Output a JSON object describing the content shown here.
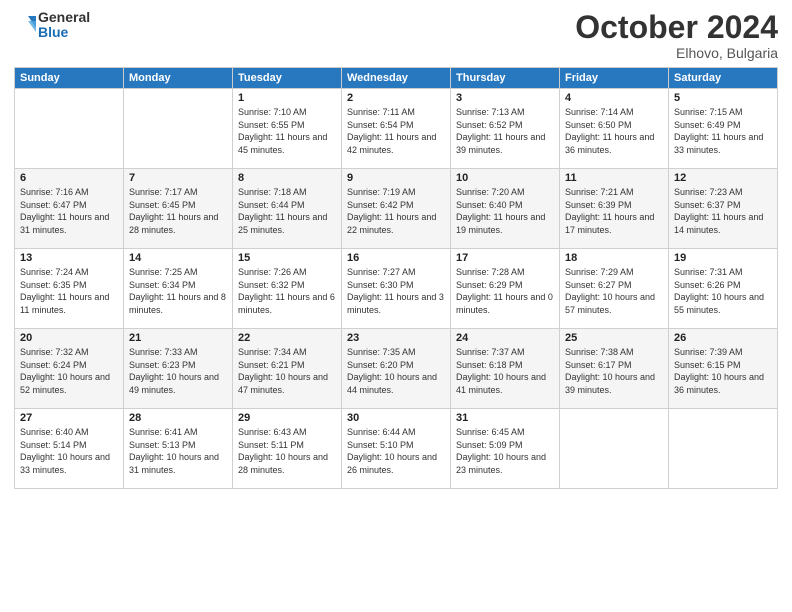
{
  "header": {
    "logo_line1": "General",
    "logo_line2": "Blue",
    "month": "October 2024",
    "location": "Elhovo, Bulgaria"
  },
  "weekdays": [
    "Sunday",
    "Monday",
    "Tuesday",
    "Wednesday",
    "Thursday",
    "Friday",
    "Saturday"
  ],
  "weeks": [
    [
      {
        "day": "",
        "info": ""
      },
      {
        "day": "",
        "info": ""
      },
      {
        "day": "1",
        "info": "Sunrise: 7:10 AM\nSunset: 6:55 PM\nDaylight: 11 hours and 45 minutes."
      },
      {
        "day": "2",
        "info": "Sunrise: 7:11 AM\nSunset: 6:54 PM\nDaylight: 11 hours and 42 minutes."
      },
      {
        "day": "3",
        "info": "Sunrise: 7:13 AM\nSunset: 6:52 PM\nDaylight: 11 hours and 39 minutes."
      },
      {
        "day": "4",
        "info": "Sunrise: 7:14 AM\nSunset: 6:50 PM\nDaylight: 11 hours and 36 minutes."
      },
      {
        "day": "5",
        "info": "Sunrise: 7:15 AM\nSunset: 6:49 PM\nDaylight: 11 hours and 33 minutes."
      }
    ],
    [
      {
        "day": "6",
        "info": "Sunrise: 7:16 AM\nSunset: 6:47 PM\nDaylight: 11 hours and 31 minutes."
      },
      {
        "day": "7",
        "info": "Sunrise: 7:17 AM\nSunset: 6:45 PM\nDaylight: 11 hours and 28 minutes."
      },
      {
        "day": "8",
        "info": "Sunrise: 7:18 AM\nSunset: 6:44 PM\nDaylight: 11 hours and 25 minutes."
      },
      {
        "day": "9",
        "info": "Sunrise: 7:19 AM\nSunset: 6:42 PM\nDaylight: 11 hours and 22 minutes."
      },
      {
        "day": "10",
        "info": "Sunrise: 7:20 AM\nSunset: 6:40 PM\nDaylight: 11 hours and 19 minutes."
      },
      {
        "day": "11",
        "info": "Sunrise: 7:21 AM\nSunset: 6:39 PM\nDaylight: 11 hours and 17 minutes."
      },
      {
        "day": "12",
        "info": "Sunrise: 7:23 AM\nSunset: 6:37 PM\nDaylight: 11 hours and 14 minutes."
      }
    ],
    [
      {
        "day": "13",
        "info": "Sunrise: 7:24 AM\nSunset: 6:35 PM\nDaylight: 11 hours and 11 minutes."
      },
      {
        "day": "14",
        "info": "Sunrise: 7:25 AM\nSunset: 6:34 PM\nDaylight: 11 hours and 8 minutes."
      },
      {
        "day": "15",
        "info": "Sunrise: 7:26 AM\nSunset: 6:32 PM\nDaylight: 11 hours and 6 minutes."
      },
      {
        "day": "16",
        "info": "Sunrise: 7:27 AM\nSunset: 6:30 PM\nDaylight: 11 hours and 3 minutes."
      },
      {
        "day": "17",
        "info": "Sunrise: 7:28 AM\nSunset: 6:29 PM\nDaylight: 11 hours and 0 minutes."
      },
      {
        "day": "18",
        "info": "Sunrise: 7:29 AM\nSunset: 6:27 PM\nDaylight: 10 hours and 57 minutes."
      },
      {
        "day": "19",
        "info": "Sunrise: 7:31 AM\nSunset: 6:26 PM\nDaylight: 10 hours and 55 minutes."
      }
    ],
    [
      {
        "day": "20",
        "info": "Sunrise: 7:32 AM\nSunset: 6:24 PM\nDaylight: 10 hours and 52 minutes."
      },
      {
        "day": "21",
        "info": "Sunrise: 7:33 AM\nSunset: 6:23 PM\nDaylight: 10 hours and 49 minutes."
      },
      {
        "day": "22",
        "info": "Sunrise: 7:34 AM\nSunset: 6:21 PM\nDaylight: 10 hours and 47 minutes."
      },
      {
        "day": "23",
        "info": "Sunrise: 7:35 AM\nSunset: 6:20 PM\nDaylight: 10 hours and 44 minutes."
      },
      {
        "day": "24",
        "info": "Sunrise: 7:37 AM\nSunset: 6:18 PM\nDaylight: 10 hours and 41 minutes."
      },
      {
        "day": "25",
        "info": "Sunrise: 7:38 AM\nSunset: 6:17 PM\nDaylight: 10 hours and 39 minutes."
      },
      {
        "day": "26",
        "info": "Sunrise: 7:39 AM\nSunset: 6:15 PM\nDaylight: 10 hours and 36 minutes."
      }
    ],
    [
      {
        "day": "27",
        "info": "Sunrise: 6:40 AM\nSunset: 5:14 PM\nDaylight: 10 hours and 33 minutes."
      },
      {
        "day": "28",
        "info": "Sunrise: 6:41 AM\nSunset: 5:13 PM\nDaylight: 10 hours and 31 minutes."
      },
      {
        "day": "29",
        "info": "Sunrise: 6:43 AM\nSunset: 5:11 PM\nDaylight: 10 hours and 28 minutes."
      },
      {
        "day": "30",
        "info": "Sunrise: 6:44 AM\nSunset: 5:10 PM\nDaylight: 10 hours and 26 minutes."
      },
      {
        "day": "31",
        "info": "Sunrise: 6:45 AM\nSunset: 5:09 PM\nDaylight: 10 hours and 23 minutes."
      },
      {
        "day": "",
        "info": ""
      },
      {
        "day": "",
        "info": ""
      }
    ]
  ]
}
